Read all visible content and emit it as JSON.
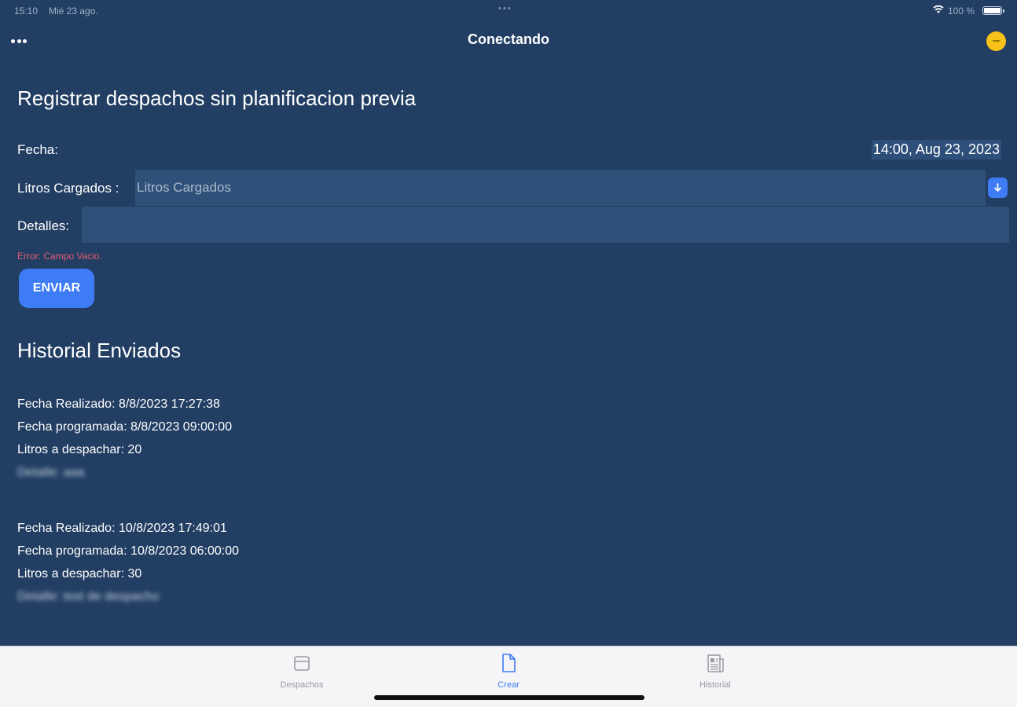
{
  "status_bar": {
    "time": "15:10",
    "date": "Mié 23 ago.",
    "battery": "100 %",
    "dots": "•••"
  },
  "navbar": {
    "title": "Conectando",
    "status_color": "#f6c21a"
  },
  "form": {
    "heading": "Registrar despachos sin planificacion previa",
    "fecha_label": "Fecha:",
    "fecha_value": "14:00, Aug 23, 2023",
    "litros_label": "Litros Cargados :",
    "litros_placeholder": "Litros Cargados",
    "litros_value": "",
    "detalles_label": "Detalles:",
    "detalles_value": "",
    "error": "Error: Campo Vacio.",
    "send_label": "ENVIAR"
  },
  "history": {
    "heading": "Historial Enviados",
    "items": [
      {
        "realizado": "Fecha Realizado: 8/8/2023 17:27:38",
        "programada": "Fecha programada: 8/8/2023 09:00:00",
        "litros": "Litros a despachar: 20",
        "detalle": "Detalle: aaa"
      },
      {
        "realizado": "Fecha Realizado: 10/8/2023 17:49:01",
        "programada": "Fecha programada: 10/8/2023 06:00:00",
        "litros": "Litros a despachar: 30",
        "detalle": "Detalle: test de despacho"
      }
    ]
  },
  "tabs": [
    {
      "label": "Despachos",
      "icon": "tray-icon"
    },
    {
      "label": "Crear",
      "icon": "document-icon",
      "active": true
    },
    {
      "label": "Historial",
      "icon": "newspaper-icon"
    }
  ],
  "colors": {
    "background": "#223e63",
    "accent": "#3d7cf5",
    "error": "#e45a6e"
  }
}
